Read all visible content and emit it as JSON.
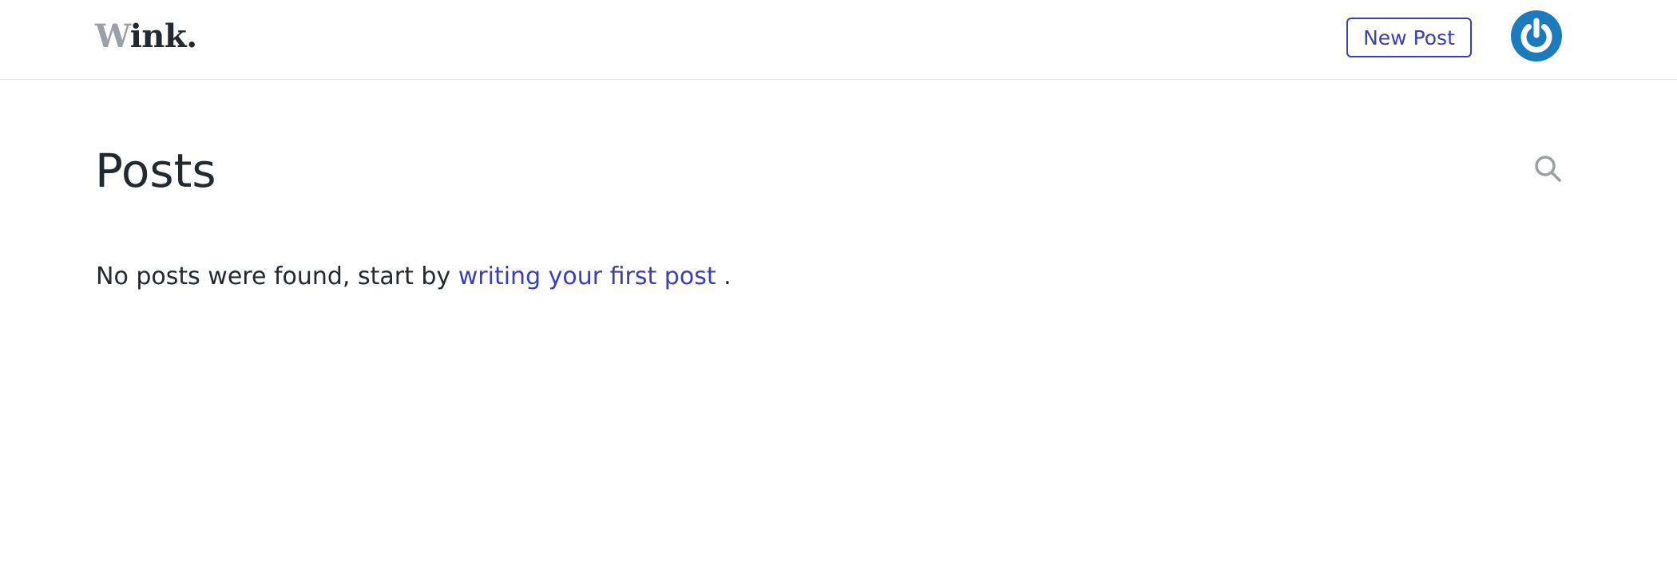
{
  "header": {
    "logo": {
      "first_letter": "W",
      "rest": "ink."
    },
    "new_post_label": "New Post",
    "avatar_icon": "power-icon"
  },
  "main": {
    "title": "Posts",
    "search_icon": "search-icon",
    "empty_state": {
      "text_before": "No posts were found, start by ",
      "link_text": "writing your first post",
      "text_after": " ."
    }
  },
  "colors": {
    "accent": "#3b3fb5",
    "avatar_bg": "#1c7bbd",
    "text": "#22292f",
    "muted": "#9aa0a6"
  }
}
